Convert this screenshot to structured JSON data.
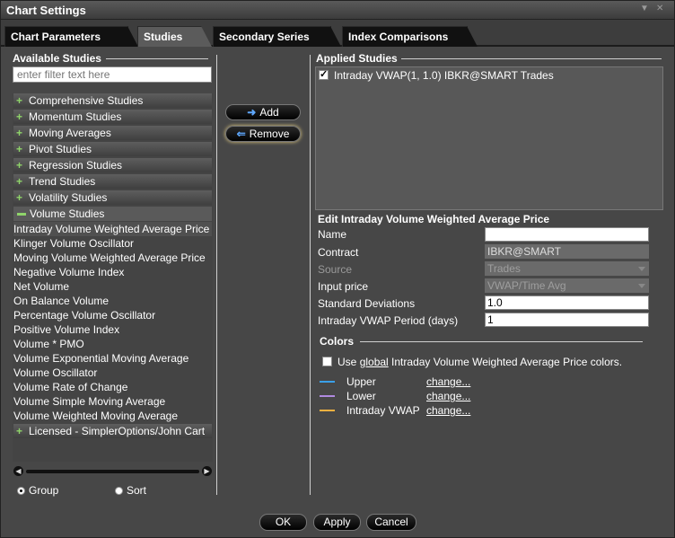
{
  "window": {
    "title": "Chart Settings"
  },
  "tabs": [
    {
      "label": "Chart Parameters",
      "active": false
    },
    {
      "label": "Studies",
      "active": true
    },
    {
      "label": "Secondary Series",
      "active": false
    },
    {
      "label": "Index Comparisons",
      "active": false
    }
  ],
  "available": {
    "heading": "Available Studies",
    "filter_placeholder": "enter filter text here",
    "groups": [
      "Comprehensive Studies",
      "Momentum Studies",
      "Moving Averages",
      "Pivot Studies",
      "Regression Studies",
      "Trend Studies",
      "Volatility Studies"
    ],
    "expanded_group": "Volume Studies",
    "volume_items": [
      "Intraday Volume Weighted Average Price",
      "Klinger Volume Oscillator",
      "Moving Volume Weighted Average Price",
      "Negative Volume Index",
      "Net Volume",
      "On Balance Volume",
      "Percentage Volume Oscillator",
      "Positive Volume Index",
      "Volume * PMO",
      "Volume Exponential Moving Average",
      "Volume Oscillator",
      "Volume Rate of Change",
      "Volume Simple Moving Average",
      "Volume Weighted Moving Average"
    ],
    "licensed_group": "Licensed - SimplerOptions/John Cart",
    "radio_group": "Group",
    "radio_sort": "Sort"
  },
  "actions": {
    "add": "Add",
    "remove": "Remove"
  },
  "applied": {
    "heading": "Applied Studies",
    "items": [
      "Intraday VWAP(1, 1.0) IBKR@SMART Trades"
    ]
  },
  "edit": {
    "title": "Edit Intraday Volume Weighted Average Price",
    "fields": {
      "name": {
        "label": "Name",
        "value": ""
      },
      "contract": {
        "label": "Contract",
        "value": "IBKR@SMART"
      },
      "source": {
        "label": "Source",
        "value": "Trades"
      },
      "input_price": {
        "label": "Input price",
        "value": "VWAP/Time Avg"
      },
      "std_dev": {
        "label": "Standard Deviations",
        "value": "1.0"
      },
      "period": {
        "label": "Intraday VWAP Period (days)",
        "value": "1"
      }
    }
  },
  "colors": {
    "heading": "Colors",
    "use_global_prefix": "Use ",
    "use_global_link": "global",
    "use_global_suffix": " Intraday Volume Weighted Average Price colors.",
    "rows": [
      {
        "label": "Upper",
        "link": "change...",
        "color": "#3aa0e8"
      },
      {
        "label": "Lower",
        "link": "change...",
        "color": "#b08ae0"
      },
      {
        "label": "Intraday VWAP",
        "link": "change...",
        "color": "#f0b040"
      }
    ]
  },
  "footer": {
    "ok": "OK",
    "apply": "Apply",
    "cancel": "Cancel"
  }
}
